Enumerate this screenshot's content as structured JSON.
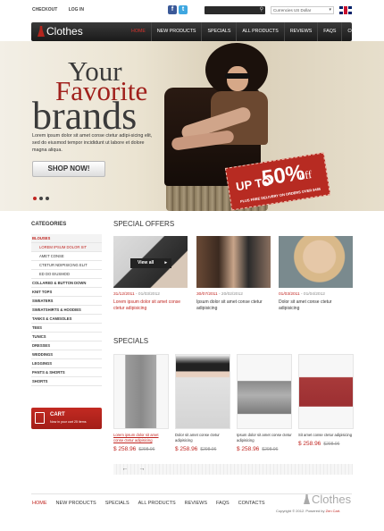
{
  "topbar": {
    "links": [
      "CHECKOUT",
      "LOG IN"
    ],
    "currency": "Currencies  US Dollar"
  },
  "nav": {
    "logo": "Clothes",
    "items": [
      "HOME",
      "NEW PRODUCTS",
      "SPECIALS",
      "ALL PRODUCTS",
      "REVIEWS",
      "FAQS",
      "CONTACTS"
    ]
  },
  "hero": {
    "line1": "Your",
    "line2": "Favorite",
    "line3": "brands",
    "text": "Lorem ipsum dolor sit amet conse ctetur adipi-sicing elit, sed do eiusmod tempor incididunt ut labore et dolore magna aliqua.",
    "button": "SHOP NOW!",
    "badge_up": "UP TO",
    "badge_pct": "50%",
    "badge_off": "off",
    "badge_free": "PLUS FREE DELIVERY ON ORDERS OVER $485"
  },
  "sidebar": {
    "title": "CATEGORIES",
    "items": [
      {
        "label": "BLOUSES",
        "style": "red"
      },
      {
        "label": "LOREM IPSUM DOLOR SIT",
        "style": "red-sub"
      },
      {
        "label": "AMET CONSE",
        "style": "sub"
      },
      {
        "label": "CTETUR NDIPISICING ELIT",
        "style": "sub"
      },
      {
        "label": "ED DO EIUSMOD",
        "style": "sub"
      },
      {
        "label": "COLLARED & BUTTON DOWN",
        "style": ""
      },
      {
        "label": "KNIT TOPS",
        "style": ""
      },
      {
        "label": "SWEATERS",
        "style": ""
      },
      {
        "label": "SWEATSHIRTS & HOODIES",
        "style": ""
      },
      {
        "label": "TANKS & CAMISOLES",
        "style": ""
      },
      {
        "label": "TEES",
        "style": ""
      },
      {
        "label": "TUNICS",
        "style": ""
      },
      {
        "label": "DRESSES",
        "style": ""
      },
      {
        "label": "WEDDINGS",
        "style": ""
      },
      {
        "label": "LEGGINGS",
        "style": ""
      },
      {
        "label": "PANTS & SHORTS",
        "style": ""
      },
      {
        "label": "SHORTS",
        "style": ""
      }
    ],
    "cart_title": "CART",
    "cart_sub": "Now in your cart 25 items"
  },
  "offers": {
    "title": "SPECIAL OFFERS",
    "view_all": "View all",
    "items": [
      {
        "date_a": "31/12/2011",
        "date_b": " - 01/03/2012",
        "text": "Lorem ipsum dolor sit amet conse ctetur adipisicing",
        "red": true
      },
      {
        "date_a": "30/07/2011",
        "date_b": " - 20/02/2012",
        "text": "Ipsum dolor sit amet conse ctetur adipisicing",
        "red": false
      },
      {
        "date_a": "01/03/2011",
        "date_b": " - 01/04/2012",
        "text": "Dolor sit amet conse ctetur adipisicing",
        "red": false
      }
    ]
  },
  "specials": {
    "title": "SPECIALS",
    "items": [
      {
        "text": "Lorem ipsum dolor sit amet conse ctetur adipisicing",
        "price": "$ 258.96",
        "old": "$298.96",
        "red": true
      },
      {
        "text": "Dolor sit amet conse ctetur adipisicing",
        "price": "$ 258.96",
        "old": "$298.96",
        "red": false
      },
      {
        "text": "Ipsum dolor sit amet conse ctetur adipisicing",
        "price": "$ 258.96",
        "old": "$298.96",
        "red": false
      },
      {
        "text": "Sit amet conse ctetur adipisicing",
        "price": "$ 258.96",
        "old": "$298.96",
        "red": false
      }
    ]
  },
  "footer": {
    "items": [
      "HOME",
      "NEW PRODUCTS",
      "SPECIALS",
      "ALL PRODUCTS",
      "REVIEWS",
      "FAQS",
      "CONTACTS"
    ],
    "logo": "Clothes",
    "copy": "Copyright © 2012. Powered by ",
    "copy_link": "Zen Cart."
  },
  "colors": {
    "accent": "#c02520",
    "nav_bg": "#1f1f1f"
  }
}
